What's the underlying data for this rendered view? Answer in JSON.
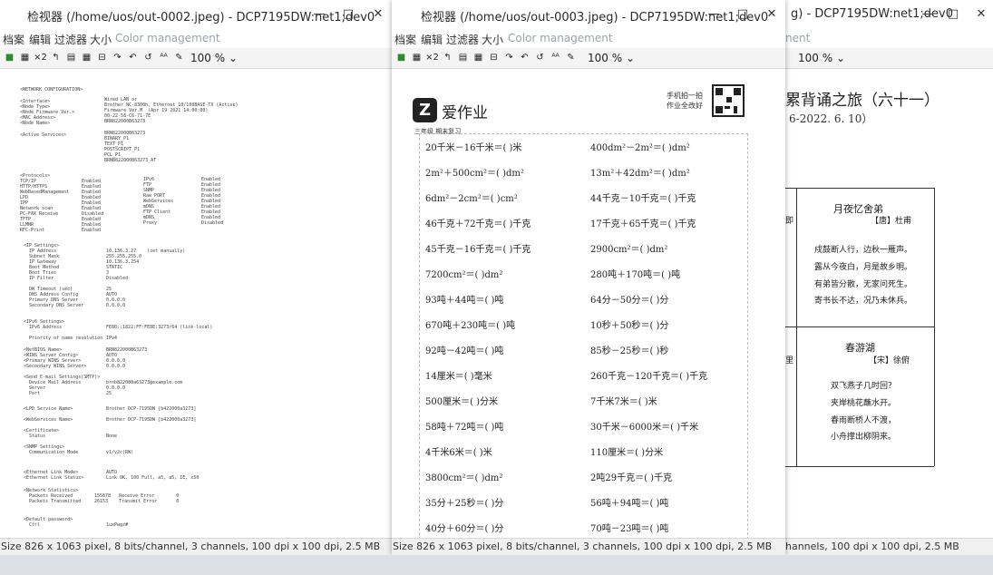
{
  "windows": [
    {
      "title": "检视器 (/home/uos/out-0002.jpeg) - DCP7195DW:net1;dev0",
      "menus": [
        "档案",
        "编辑",
        "过滤器",
        "大小",
        "Color management"
      ],
      "zoom": "100 %",
      "status": "Size 826 x 1063 pixel, 8 bits/channel, 3 channels, 100 dpi x 100 dpi, 2.5 MB"
    },
    {
      "title": "检视器 (/home/uos/out-0003.jpeg) - DCP7195DW:net1;dev0",
      "menus": [
        "档案",
        "编辑",
        "过滤器",
        "大小",
        "Color management"
      ],
      "zoom": "100 %",
      "status": "Size 826 x 1063 pixel, 8 bits/channel, 3 channels, 100 dpi x 100 dpi, 2.5 MB"
    },
    {
      "title": "g) - DCP7195DW:net1;dev0",
      "menus": [
        "nent"
      ],
      "zoom": "100 %",
      "status": "hannels, 100 dpi x 100 dpi, 2.5 MB"
    }
  ],
  "window_buttons": {
    "minimize": "—",
    "maximize": "□",
    "close": "✕"
  },
  "toolbar_icons": [
    "save-icon",
    "scan-icon",
    "zoom-2x-icon",
    "rotate-left-icon",
    "layout-icon",
    "grid-icon",
    "page-icon",
    "redo-icon",
    "undo-icon",
    "refresh-icon",
    "aa-icon",
    "pencil-icon"
  ],
  "config_sheet": {
    "header": "<NETWORK CONFIGURATION>",
    "block1_labels": "<Interface>\n<Node Type>\n<Node Firmware Ver.>\n<MAC Address>\n<Node Name>",
    "block1_values": "Wired LAN or\nBrother NC-8300h, Ethernet 10/100BASE-TX (Active)\nFirmware Ver.M  (Apr 19 2021 14:00:00)\n00-22-58-C6-71-7E\nBRN822000B63273",
    "active_label": "<Active Services>",
    "active_values": "BRN822000B63273\nBINARY_P1\nTEXT_P1\nPOSTSCRIPT_P1\nPCL_P1\nBRNB822000B63273_AT",
    "protocols_label": "<Protocols>\nTCP/IP\nHTTP/HTTPS\nWebBasedManagement\nLPD\nIPP\nNetwork scan\nPC-FAX Receive\nTFTP\nLLMNR\nRFC-Print",
    "protocols_state": "\nEnabled\nEnabled\nEnabled\nEnabled\nEnabled\nEnabled\nDisabled\nEnabled\nEnabled\nEnabled",
    "protocols2": "\nIPv6\nFTP\nSNMP\nRaw PORT\nWebServices\nmDNS\nFTP Client\nmDNS\nProxy",
    "protocols2_state": "\nEnabled\nEnabled\nEnabled\nEnabled\nEnabled\nEnabled\nEnabled\nEnabled\nDisabled",
    "ip_labels": "<IP Settings>\n  IP Address\n  Subnet Mask\n  IP Gateway\n  Boot Method\n  Boot Tries\n  IP Filter\n\n  DW Timeout (sec)\n  DNS Address Config\n  Primary DNS Server\n  Secondary DNS Server",
    "ip_values": "\n10.136.3.27    (set manually)\n255.255.255.0\n10.136.3.254\nSTATIC\n3\nDisabled\n\n25\nAUTO\n0.0.0.0\n0.0.0.0",
    "ipv6_labels": "<IPv6 Settings>\n  IPv6 Address\n\n  Priority of name resolution",
    "ipv6_values": "\nFE80::1822:FF:FE8E:3273/64 (link-local)\n\nIPv4",
    "netbios_labels": "<NetBIOS Name>\n<WINS Server Config>\n<Primary WINS Server>\n<Secondary WINS Server>\n\n<Send E-mail Settings(SMTP)>\n  Device Mail Address\n  Server\n  Port",
    "netbios_values": "BRN822000B63273\nAUTO\n0.0.0.0\n0.0.0.0\n\n\nbrnb822000a63273@example.com\n0.0.0.0\n25",
    "service_labels": "<LPD Service Name>\n\n<WebServices Name>\n\n<Certificate>\n  Status\n\n<SNMP Settings>\n  Communication Mode",
    "service_values": "Brother DCP-7195DW [b422000a3273]\n\nBrother DCP-7195DW [b422000a3273]\n\n\nNone\n\n\nv1/v2c(RW)",
    "ethernet_labels": "<Ethernet Link Mode>\n<Ethernet Link Status>",
    "ethernet_values": "AUTO\nLink OK, 100 Full, a5, a5, IE, x50",
    "stats_labels": "<Network Statistics>\n  Packets Received\n  Packets Transmitted",
    "stats_values": "\n155678   Receive Error        0\n26153    Transmit Error       0",
    "password_labels": "<Default password>\n  Ctrl",
    "password_values": "\n1uxPwgz#"
  },
  "math_sheet": {
    "logo_letter": "Z",
    "logo_text": "爱作业",
    "scan_note": [
      "手机拍一拍",
      "作业全改好"
    ],
    "subtitle": "三年级  期末复习",
    "problems": [
      [
        "20千米－16千米＝(    )米",
        "400dm²－2m²＝(    )dm²"
      ],
      [
        "2m²＋500cm²＝(    )dm²",
        "13m²＋42dm²＝(    )dm²"
      ],
      [
        "6dm²－2cm²＝(    )cm²",
        "44千克－10千克＝(    )千克"
      ],
      [
        "46千克＋72千克＝(    )千克",
        "17千克＋65千克＝(    )千克"
      ],
      [
        "45千克－16千克＝(    )千克",
        "2900cm²＝(    )dm²"
      ],
      [
        "7200cm²＝(    )dm²",
        "280吨＋170吨＝(    )吨"
      ],
      [
        "93吨＋44吨＝(    )吨",
        "64分－50分＝(    )分"
      ],
      [
        "670吨＋230吨＝(    )吨",
        "10秒＋50秒＝(    )分"
      ],
      [
        "92吨－42吨＝(    )吨",
        "85秒－25秒＝(    )秒"
      ],
      [
        "14厘米＝(    )毫米",
        "260千克－120千克＝(    )千克"
      ],
      [
        "500厘米＝(    )分米",
        "7千米7米＝(    )米"
      ],
      [
        "58吨＋72吨＝(    )吨",
        "30千米－6000米＝(    )千米"
      ],
      [
        "4千米6米＝(    )米",
        "110厘米＝(    )分米"
      ],
      [
        "3800cm²＝(    )dm²",
        "2吨29千克＝(    )千克"
      ],
      [
        "35分＋25秒＝(    )分",
        "56吨＋94吨＝(    )吨"
      ],
      [
        "40分＋60分＝(    )分",
        "70吨－23吨＝(    )吨"
      ]
    ]
  },
  "poem_sheet": {
    "title": "累背诵之旅（六十一）",
    "date": "6-2022. 6. 10）",
    "side1": "即",
    "poem1_title": "月夜忆舍弟",
    "poem1_author": "【唐】杜甫",
    "poem1_lines": [
      "戍鼓断人行，边秋一雁声。",
      "露从今夜白，月是故乡明。",
      "有弟皆分散，无家问死生。",
      "寄书长不达，况乃未休兵。"
    ],
    "side2": "里",
    "poem2_title": "春游湖",
    "poem2_author": "【宋】徐俯",
    "poem2_lines": [
      "双飞燕子几时回？",
      "夹岸桃花蘸水开。",
      "春雨断桥人不渡，",
      "小舟撑出柳阴来。"
    ]
  }
}
